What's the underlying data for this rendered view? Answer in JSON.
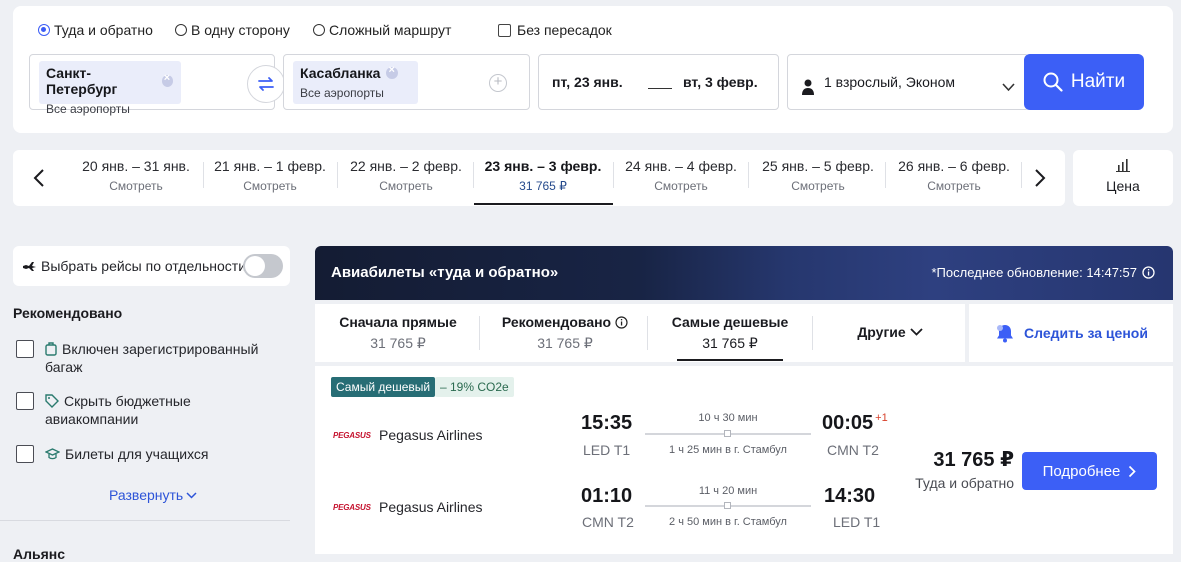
{
  "search": {
    "trip_types": [
      "Туда и обратно",
      "В одну сторону",
      "Сложный маршрут"
    ],
    "selected_trip_type": "Туда и обратно",
    "nonstop_label": "Без пересадок",
    "origin": {
      "city": "Санкт-Петербург",
      "sub": "Все аэропорты"
    },
    "destination": {
      "city": "Касабланка",
      "sub": "Все аэропорты"
    },
    "depart_date": "пт, 23 янв.",
    "return_date": "вт, 3 февр.",
    "passengers": "1 взрослый, Эконом",
    "search_button": "Найти"
  },
  "date_strip": {
    "items": [
      {
        "range": "20 янв. – 31 янв.",
        "label": "Смотреть"
      },
      {
        "range": "21 янв. – 1 февр.",
        "label": "Смотреть"
      },
      {
        "range": "22 янв. – 2 февр.",
        "label": "Смотреть"
      },
      {
        "range": "23 янв. – 3 февр.",
        "label": "31 765 ₽"
      },
      {
        "range": "24 янв. – 4 февр.",
        "label": "Смотреть"
      },
      {
        "range": "25 янв. – 5 февр.",
        "label": "Смотреть"
      },
      {
        "range": "26 янв. – 6 февр.",
        "label": "Смотреть"
      }
    ],
    "active_index": 3,
    "price_button": "Цена"
  },
  "filters": {
    "toggle_label": "Выбрать рейсы по отдельности",
    "section_title": "Рекомендовано",
    "options": [
      {
        "line1": "Включен зарегистрированный",
        "line2": "багаж"
      },
      {
        "line1": "Скрыть бюджетные",
        "line2": "авиакомпании"
      },
      {
        "line1": "Билеты для учащихся",
        "line2": ""
      }
    ],
    "expand_label": "Развернуть",
    "next_section": "Альянс"
  },
  "results": {
    "banner_title": "Авиабилеты «туда и обратно»",
    "banner_update": "*Последнее обновление: 14:47:57",
    "sort_tabs": [
      {
        "name": "Сначала прямые",
        "price": "31 765 ₽"
      },
      {
        "name": "Рекомендовано",
        "price": "31 765 ₽"
      },
      {
        "name": "Самые дешевые",
        "price": "31 765 ₽"
      }
    ],
    "active_sort": 2,
    "other_label": "Другие",
    "watch_label": "Следить за ценой",
    "ticket": {
      "badge_cheapest": "Самый дешевый",
      "badge_co2": "– 19% CO2e",
      "price": "31 765 ₽",
      "price_sub": "Туда и обратно",
      "details_button": "Подробнее",
      "airline_logo_text": "PEGASUS",
      "legs": [
        {
          "airline": "Pegasus Airlines",
          "dep_time": "15:35",
          "dep_code": "LED T1",
          "arr_time": "00:05",
          "arr_plus": "+1",
          "arr_code": "CMN T2",
          "duration": "10 ч 30 мин",
          "layover": "1 ч 25 мин в г. Стамбул"
        },
        {
          "airline": "Pegasus Airlines",
          "dep_time": "01:10",
          "dep_code": "CMN T2",
          "arr_time": "14:30",
          "arr_plus": "",
          "arr_code": "LED T1",
          "duration": "11 ч 20 мин",
          "layover": "2 ч 50 мин в г. Стамбул"
        }
      ]
    }
  },
  "colors": {
    "accent": "#3c5ff6",
    "badge": "#276d75",
    "link": "#2d54d8"
  }
}
